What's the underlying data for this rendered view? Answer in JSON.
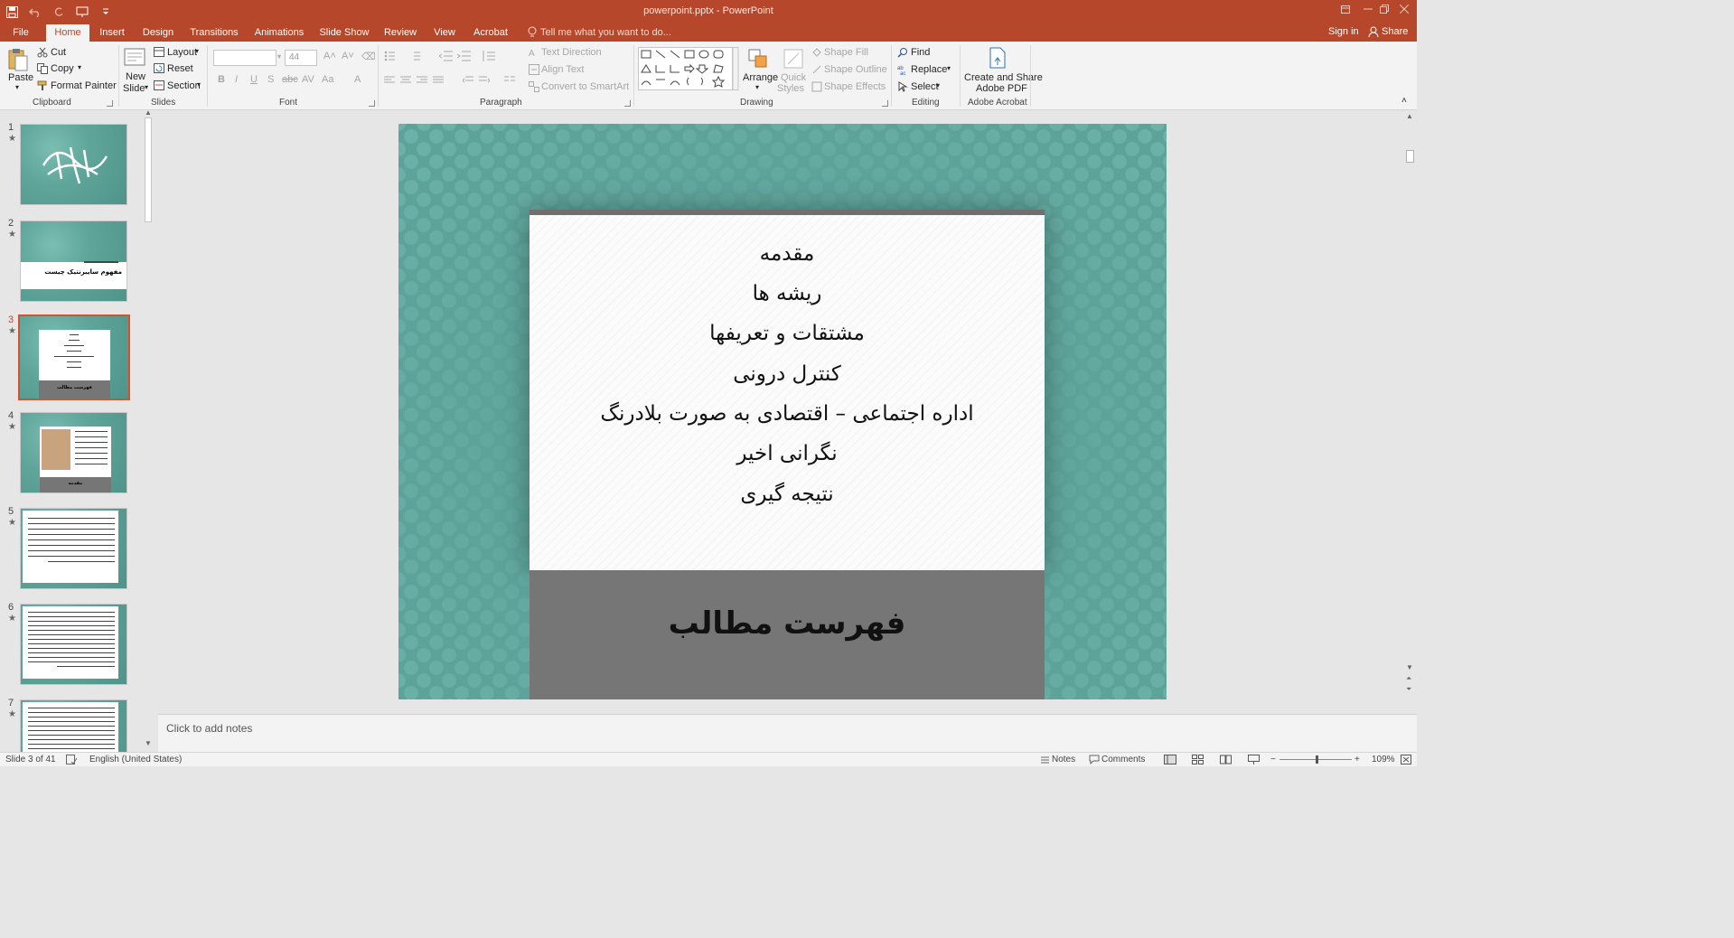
{
  "app": {
    "window_title": "powerpoint.pptx - PowerPoint",
    "accent": "#b7472a"
  },
  "tabs": [
    {
      "label": "File"
    },
    {
      "label": "Home"
    },
    {
      "label": "Insert"
    },
    {
      "label": "Design"
    },
    {
      "label": "Transitions"
    },
    {
      "label": "Animations"
    },
    {
      "label": "Slide Show"
    },
    {
      "label": "Review"
    },
    {
      "label": "View"
    },
    {
      "label": "Acrobat"
    }
  ],
  "active_tab": "Home",
  "tellme": "Tell me what you want to do...",
  "signin": "Sign in",
  "share": "Share",
  "ribbon": {
    "clipboard": {
      "paste": "Paste",
      "cut": "Cut",
      "copy": "Copy",
      "format_painter": "Format Painter",
      "group": "Clipboard"
    },
    "slides": {
      "new_slide_1": "New",
      "new_slide_2": "Slide",
      "layout": "Layout",
      "reset": "Reset",
      "section": "Section",
      "group": "Slides"
    },
    "font": {
      "font_size": "44",
      "group": "Font"
    },
    "paragraph": {
      "text_direction": "Text Direction",
      "align_text": "Align Text",
      "convert_smartart": "Convert to SmartArt",
      "group": "Paragraph"
    },
    "drawing": {
      "arrange": "Arrange",
      "quick_styles_1": "Quick",
      "quick_styles_2": "Styles",
      "shape_fill": "Shape Fill",
      "shape_outline": "Shape Outline",
      "shape_effects": "Shape Effects",
      "group": "Drawing"
    },
    "editing": {
      "find": "Find",
      "replace": "Replace",
      "select": "Select",
      "group": "Editing"
    },
    "acrobat": {
      "create_1": "Create and Share",
      "create_2": "Adobe PDF",
      "group": "Adobe Acrobat"
    }
  },
  "thumbnails": [
    {
      "num": "1",
      "star": "★"
    },
    {
      "num": "2",
      "star": "★",
      "title": "مفهوم سایبرنتیک چیست"
    },
    {
      "num": "3",
      "star": "★",
      "title": "فهرست مطالب"
    },
    {
      "num": "4",
      "star": "★",
      "title": "مقدمه"
    },
    {
      "num": "5",
      "star": "★"
    },
    {
      "num": "6",
      "star": "★"
    },
    {
      "num": "7",
      "star": "★"
    }
  ],
  "slide": {
    "items": [
      "مقدمه",
      "ریشه ها",
      "مشتقات و تعریفها",
      "کنترل درونی",
      "اداره اجتماعی – اقتصادی به صورت بلادرنگ",
      "نگرانی اخیر",
      "نتیجه گیری"
    ],
    "title": "فهرست مطالب",
    "teal": "#5da39a",
    "band": "#767676"
  },
  "notes_placeholder": "Click to add notes",
  "status": {
    "slide": "Slide 3 of 41",
    "language": "English (United States)",
    "notes": "Notes",
    "comments": "Comments",
    "zoom": "109%"
  }
}
